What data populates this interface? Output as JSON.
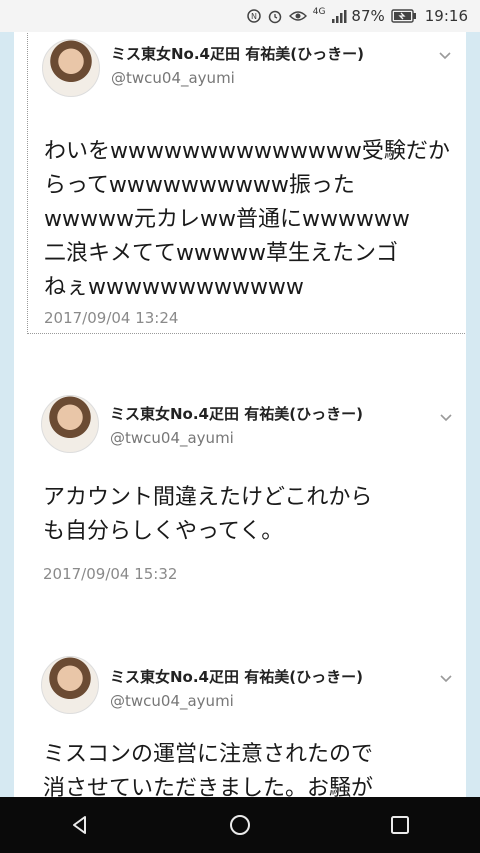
{
  "status_bar": {
    "network": "4G",
    "battery": "87%",
    "time": "19:16"
  },
  "tweets": [
    {
      "name": "ミス東女No.4疋田 有祐美(ひっきー)",
      "handle": "@twcu04_ayumi",
      "text": "わいをwwwwwwwwwwwwww受験だか\nらってwwwwwwwwww振った\nwwwww元カレww普通にwwwwww\n二浪キメててwwwww草生えたンゴ\nねぇwwwwwwwwwwww",
      "timestamp": "2017/09/04 13:24"
    },
    {
      "name": "ミス東女No.4疋田 有祐美(ひっきー)",
      "handle": "@twcu04_ayumi",
      "text": "アカウント間違えたけどこれから\nも自分らしくやってく。",
      "timestamp": "2017/09/04 15:32"
    },
    {
      "name": "ミス東女No.4疋田 有祐美(ひっきー)",
      "handle": "@twcu04_ayumi",
      "text": "ミスコンの運営に注意されたので\n消させていただきました。お騒が"
    }
  ],
  "icons": {
    "back": "back-icon",
    "home": "home-icon",
    "recents": "recents-icon"
  }
}
